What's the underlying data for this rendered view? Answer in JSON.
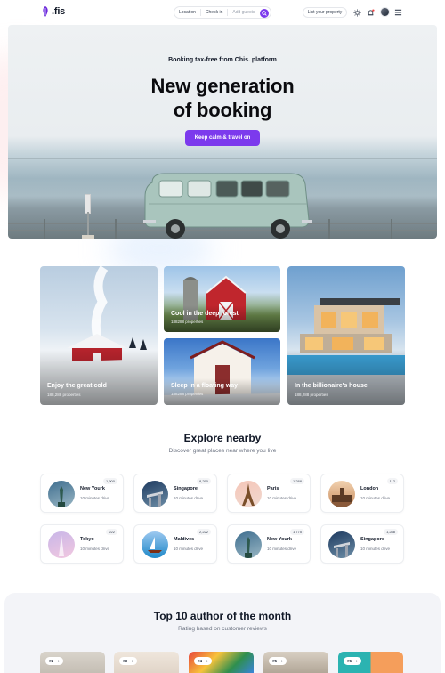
{
  "header": {
    "logo_text": ".fis",
    "search": {
      "location": "Location",
      "checkin": "Check in",
      "guests": "Add guests"
    },
    "list_property": "List your property",
    "icons": [
      "sun-icon",
      "bell-icon",
      "avatar",
      "menu-icon"
    ],
    "accent": "#7c3aed"
  },
  "hero": {
    "subtitle": "Booking tax-free from Chis. platform",
    "title_line1": "New generation",
    "title_line2": "of booking",
    "cta": "Keep calm & travel on"
  },
  "features": [
    {
      "title": "Enjoy the great cold",
      "count": "188,288 properties"
    },
    {
      "title": "Cool in the deep forest",
      "count": "188288 properties"
    },
    {
      "title": "Sleep in a floating way",
      "count": "188288 properties"
    },
    {
      "title": "In the billionaire's house",
      "count": "188,288 properties"
    }
  ],
  "nearby": {
    "title": "Explore nearby",
    "subtitle": "Discover great places near where you live",
    "items": [
      {
        "name": "New Yourk",
        "drive": "10 minutes drive",
        "badge": "1,900"
      },
      {
        "name": "Singapore",
        "drive": "10 minutes drive",
        "badge": "8,290"
      },
      {
        "name": "Paris",
        "drive": "10 minutes drive",
        "badge": "1,288"
      },
      {
        "name": "London",
        "drive": "10 minutes drive",
        "badge": "112"
      },
      {
        "name": "Tokyo",
        "drive": "10 minutes drive",
        "badge": "222"
      },
      {
        "name": "Maldives",
        "drive": "10 minutes drive",
        "badge": "2,222"
      },
      {
        "name": "New Yourk",
        "drive": "10 minutes drive",
        "badge": "1,775"
      },
      {
        "name": "Singapore",
        "drive": "10 minutes drive",
        "badge": "1,288"
      }
    ]
  },
  "authors": {
    "title": "Top 10 author of the month",
    "subtitle": "Rating based on customer reviews",
    "cards": [
      {
        "rank": "#2"
      },
      {
        "rank": "#3"
      },
      {
        "rank": "#4"
      },
      {
        "rank": "#5"
      },
      {
        "rank": "#6"
      }
    ]
  }
}
